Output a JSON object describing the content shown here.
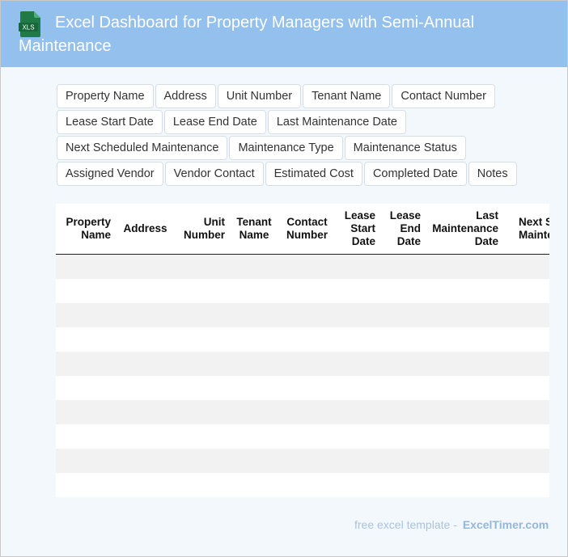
{
  "header": {
    "title": "Excel Dashboard for Property Managers with Semi-Annual Maintenance",
    "icon": "excel-xls-icon",
    "icon_label": "XLS",
    "bg_color": "#93c0ec"
  },
  "field_chips": [
    [
      "Property Name",
      "Address",
      "Unit Number",
      "Tenant Name",
      "Contact Number"
    ],
    [
      "Lease Start Date",
      "Lease End Date",
      "Last Maintenance Date"
    ],
    [
      "Next Scheduled Maintenance",
      "Maintenance Type",
      "Maintenance Status"
    ],
    [
      "Assigned Vendor",
      "Vendor Contact",
      "Estimated Cost",
      "Completed Date",
      "Notes"
    ]
  ],
  "table": {
    "columns": [
      "Property Name",
      "Address",
      "Unit Number",
      "Tenant Name",
      "Contact Number",
      "Lease Start Date",
      "Lease End Date",
      "Last Maintenance Date",
      "Next Scheduled Maintenance"
    ],
    "empty_row_count": 10
  },
  "footer": {
    "text": "free excel template -",
    "brand": "ExcelTimer.com"
  }
}
